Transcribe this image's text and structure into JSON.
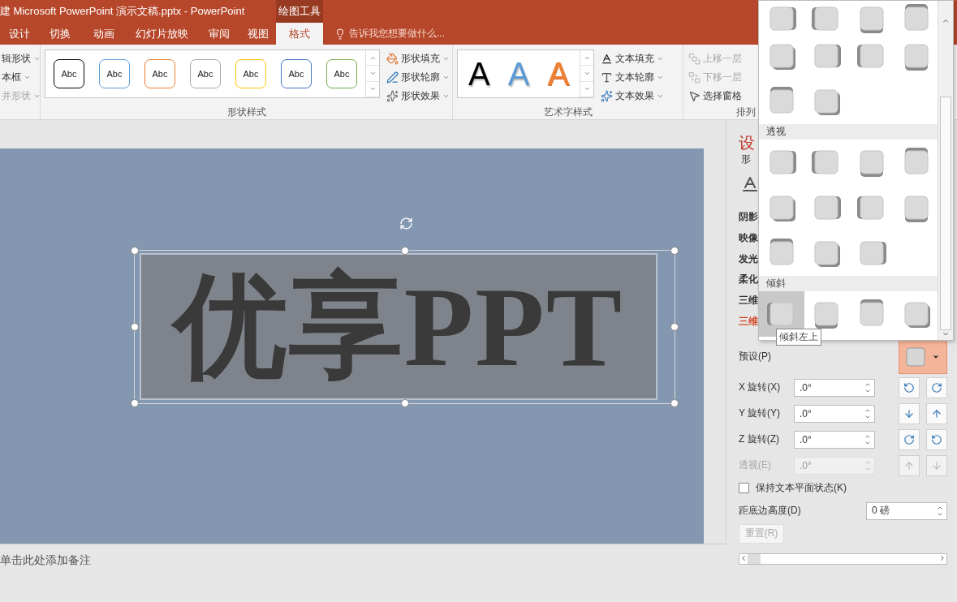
{
  "window": {
    "title": "建 Microsoft PowerPoint 演示文稿.pptx - PowerPoint",
    "context_tab": "绘图工具"
  },
  "tabs": [
    {
      "label": "设计",
      "selected": false
    },
    {
      "label": "切换",
      "selected": false
    },
    {
      "label": "动画",
      "selected": false
    },
    {
      "label": "幻灯片放映",
      "selected": false
    },
    {
      "label": "审阅",
      "selected": false
    },
    {
      "label": "视图",
      "selected": false
    },
    {
      "label": "格式",
      "selected": true
    }
  ],
  "tell_me": {
    "placeholder": "告诉我您想要做什么..."
  },
  "ribbon": {
    "insert_shapes": [
      {
        "label": "辑形状",
        "disabled": false
      },
      {
        "label": "本框",
        "disabled": false
      },
      {
        "label": "并形状",
        "disabled": true
      }
    ],
    "shape_styles": {
      "label": "形状样式",
      "swatches": [
        {
          "text": "Abc",
          "color": "#000000"
        },
        {
          "text": "Abc",
          "color": "#5b9bd5"
        },
        {
          "text": "Abc",
          "color": "#ed7d31"
        },
        {
          "text": "Abc",
          "color": "#a5a5a5"
        },
        {
          "text": "Abc",
          "color": "#ffc000"
        },
        {
          "text": "Abc",
          "color": "#4472c4"
        },
        {
          "text": "Abc",
          "color": "#70ad47"
        }
      ],
      "commands": [
        {
          "label": "形状填充",
          "kind": "fill"
        },
        {
          "label": "形状轮廓",
          "kind": "outline"
        },
        {
          "label": "形状效果",
          "kind": "effect"
        }
      ]
    },
    "wordart_styles": {
      "label": "艺术字样式",
      "samples": [
        {
          "text": "A",
          "kind": "solid",
          "color": "#000000"
        },
        {
          "text": "A",
          "kind": "solid",
          "color": "#5b9bd5"
        },
        {
          "text": "A",
          "kind": "outline",
          "color": "#ed7d31"
        }
      ],
      "commands": [
        {
          "label": "文本填充",
          "kind": "fill"
        },
        {
          "label": "文本轮廓",
          "kind": "outline"
        },
        {
          "label": "文本效果",
          "kind": "effect"
        }
      ]
    },
    "arrange": {
      "label": "排列",
      "commands": [
        {
          "label": "上移一层",
          "kind": "forward",
          "disabled": true
        },
        {
          "label": "下移一层",
          "kind": "backward",
          "disabled": true
        },
        {
          "label": "选择窗格",
          "kind": "pane",
          "disabled": false
        }
      ]
    }
  },
  "slide": {
    "text": "优享PPT",
    "selected": true
  },
  "notes": {
    "placeholder": "单击此处添加备注"
  },
  "format_pane": {
    "title": "设",
    "subtitle": "形",
    "sections": [
      {
        "label": "阴影",
        "active": false
      },
      {
        "label": "映像",
        "active": false
      },
      {
        "label": "发光",
        "active": false
      },
      {
        "label": "柔化",
        "active": false
      },
      {
        "label": "三维",
        "active": false
      },
      {
        "label": "三维",
        "active": true
      }
    ],
    "preset": {
      "label": "预设(P)"
    },
    "rotations": [
      {
        "label": "X 旋转(X)",
        "value": ".0°",
        "disabled": false,
        "kind": "x"
      },
      {
        "label": "Y 旋转(Y)",
        "value": ".0°",
        "disabled": false,
        "kind": "y"
      },
      {
        "label": "Z 旋转(Z)",
        "value": ".0°",
        "disabled": false,
        "kind": "z"
      },
      {
        "label": "透视(E)",
        "value": ".0°",
        "disabled": true,
        "kind": "perspective"
      }
    ],
    "keep_flat": {
      "label": "保持文本平面状态(K)",
      "checked": false
    },
    "depth": {
      "label": "距底边高度(D)",
      "value": "0 磅"
    },
    "reset": {
      "label": "重置(R)",
      "disabled": true
    }
  },
  "gallery": {
    "sections": [
      {
        "items": [
          {
            "selected": false
          },
          {
            "selected": false
          },
          {
            "selected": false
          },
          {
            "selected": false
          },
          {
            "selected": false
          },
          {
            "selected": false
          },
          {
            "selected": false
          },
          {
            "selected": false
          },
          {
            "selected": false
          },
          {
            "selected": false
          }
        ]
      },
      {
        "title": "透视",
        "items": [
          {
            "selected": false
          },
          {
            "selected": false
          },
          {
            "selected": false
          },
          {
            "selected": false
          },
          {
            "selected": false
          },
          {
            "selected": false
          },
          {
            "selected": false
          },
          {
            "selected": false
          },
          {
            "selected": false
          },
          {
            "selected": false
          },
          {
            "selected": false
          }
        ]
      },
      {
        "title": "倾斜",
        "items": [
          {
            "selected": true
          },
          {
            "selected": false
          },
          {
            "selected": false
          },
          {
            "selected": false
          }
        ]
      }
    ],
    "tooltip": "倾斜左上"
  }
}
